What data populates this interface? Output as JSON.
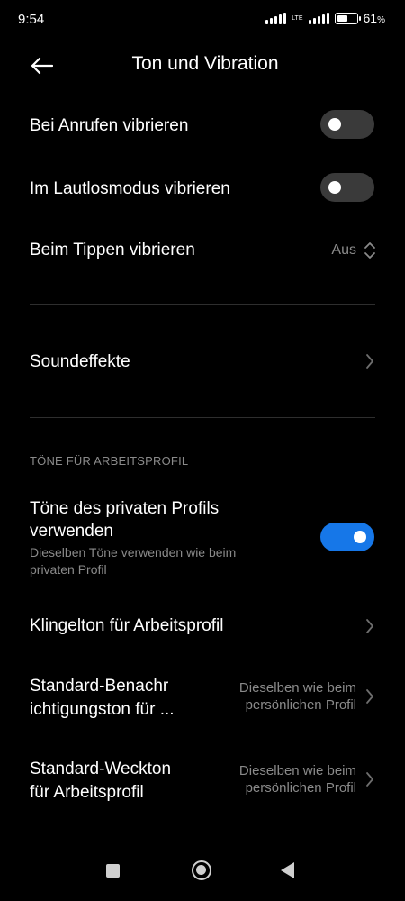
{
  "status_bar": {
    "time": "9:54",
    "network": "LTE",
    "battery_percent_label": "61",
    "battery_percent_symbol": "%",
    "battery_level": 0.61
  },
  "header": {
    "back_icon": "arrow-left-icon",
    "title": "Ton und Vibration"
  },
  "settings": {
    "vibrate_calls": {
      "label": "Bei Anrufen vibrieren",
      "enabled": false
    },
    "vibrate_silent": {
      "label": "Im Lautlosmodus vibrieren",
      "enabled": false
    },
    "vibrate_tap": {
      "label": "Beim Tippen vibrieren",
      "value": "Aus"
    },
    "sound_effects": {
      "label": "Soundeffekte"
    }
  },
  "work_profile": {
    "section_title": "TÖNE FÜR ARBEITSPROFIL",
    "use_private_tones": {
      "label_line1": "Töne des privaten Profils",
      "label_line2": "verwenden",
      "sub_line1": "Dieselben Töne verwenden wie beim",
      "sub_line2": "privaten Profil",
      "enabled": true
    },
    "ringtone": {
      "label": "Klingelton für Arbeitsprofil"
    },
    "notification_tone": {
      "label_line1": "Standard-Benachr",
      "label_line2": "ichtigungston für ...",
      "value_line1": "Dieselben wie beim",
      "value_line2": "persönlichen Profil"
    },
    "alarm_tone": {
      "label_line1": "Standard-Weckton",
      "label_line2": "für Arbeitsprofil",
      "value_line1": "Dieselben wie beim",
      "value_line2": "persönlichen Profil"
    }
  },
  "nav_bar": {
    "recents_icon": "square-icon",
    "home_icon": "circle-home-icon",
    "back_icon": "triangle-back-icon"
  },
  "colors": {
    "background": "#000000",
    "accent": "#1677e8",
    "toggle_off": "#3a3a3a",
    "secondary_text": "#8a8a8a"
  }
}
